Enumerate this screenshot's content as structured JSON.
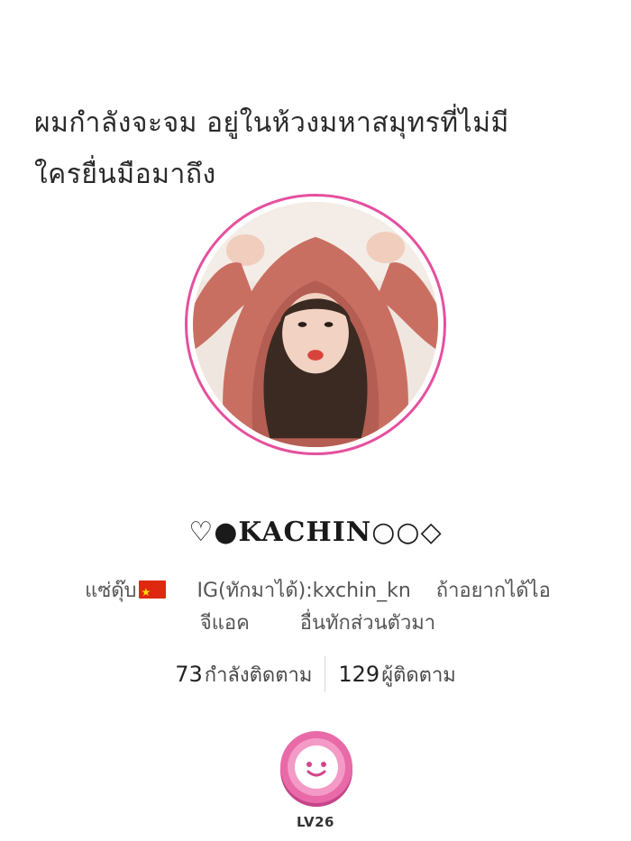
{
  "cover_caption": {
    "line1": "ผมกำลังจะจม อยู่ในห้วงมหาสมุทรที่ไม่มี",
    "line2": "ใครยื่นมือมาถึง"
  },
  "profile": {
    "avatar_alt": "profile photo",
    "username": "♡●KACHIN○○◇",
    "bio": {
      "line1_part1": "แซ่ดุ๊บ",
      "line1_part2": "     IG(ทักมาได้):kxchin_kn    ถ้าอยากได้ไอ",
      "line2": "จีแอค        อื่นทักส่วนตัวมา",
      "flag_icon": "china-flag-icon"
    }
  },
  "stats": {
    "following_count": "73",
    "following_label": "กำลังติดตาม",
    "followers_count": "129",
    "followers_label": "ผู้ติดตาม"
  },
  "level": {
    "label": "LV26",
    "icon": "smiley-coin-icon"
  },
  "colors": {
    "avatar_ring": "#e5509e",
    "badge_pink": "#e96aa8",
    "flag_red": "#de2910"
  }
}
